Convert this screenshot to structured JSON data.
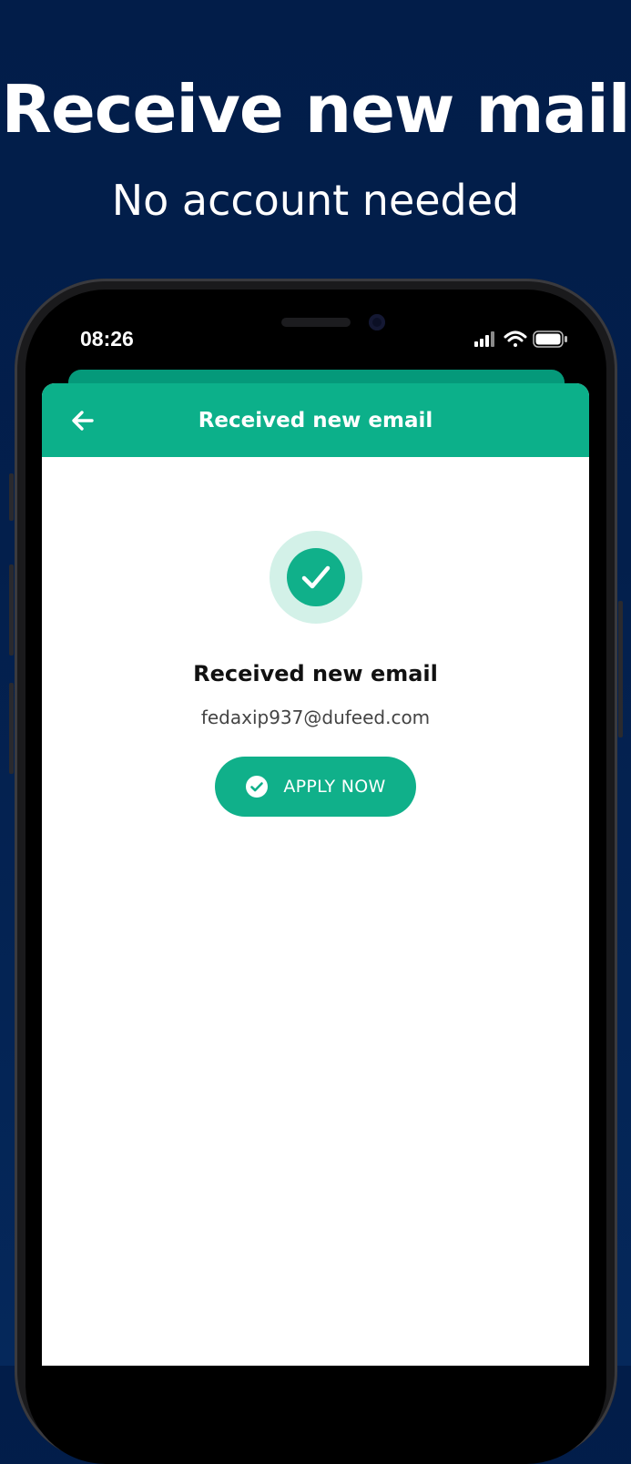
{
  "promo": {
    "headline": "Receive new mail",
    "subheadline": "No account needed"
  },
  "status_bar": {
    "time": "08:26",
    "icons": [
      "cellular-signal-icon",
      "wifi-icon",
      "battery-icon"
    ]
  },
  "app": {
    "header": {
      "back_icon": "arrow-left-icon",
      "title": "Received new email"
    },
    "success": {
      "icon": "checkmark-circle-icon",
      "title": "Received new email",
      "email": "fedaxip937@dufeed.com"
    },
    "apply_button": {
      "icon": "check-circle-icon",
      "label": "APPLY NOW"
    }
  },
  "colors": {
    "background": "#021d49",
    "accent": "#0cb08a",
    "success_halo": "#d3f1e8",
    "text_dark": "#111111",
    "text_muted": "#444444"
  }
}
